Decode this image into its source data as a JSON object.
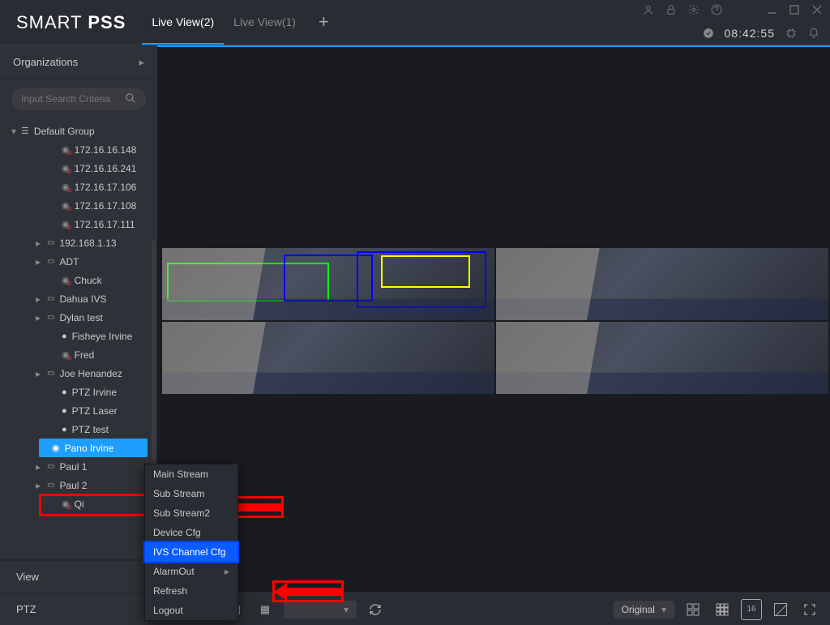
{
  "app": {
    "brand1": "SMART",
    "brand2": "PSS"
  },
  "tabs": [
    {
      "label": "Live View(2)",
      "active": true
    },
    {
      "label": "Live View(1)",
      "active": false
    }
  ],
  "clock": "08:42:55",
  "sidebar_header": "Organizations",
  "search_placeholder": "Input Search Criteria",
  "tree": {
    "group": "Default Group",
    "items": [
      {
        "label": "172.16.16.148",
        "kind": "cam",
        "offline": true
      },
      {
        "label": "172.16.16.241",
        "kind": "cam",
        "offline": true
      },
      {
        "label": "172.16.17.106",
        "kind": "cam",
        "offline": true
      },
      {
        "label": "172.16.17.108",
        "kind": "cam",
        "offline": true
      },
      {
        "label": "172.16.17.111",
        "kind": "cam",
        "offline": true
      },
      {
        "label": "192.168.1.13",
        "kind": "device",
        "expandable": true
      },
      {
        "label": "ADT",
        "kind": "device",
        "expandable": true
      },
      {
        "label": "Chuck",
        "kind": "cam",
        "offline": true
      },
      {
        "label": "Dahua IVS",
        "kind": "device",
        "expandable": true
      },
      {
        "label": "Dylan test",
        "kind": "device",
        "expandable": true
      },
      {
        "label": "Fisheye Irvine",
        "kind": "cam-on"
      },
      {
        "label": "Fred",
        "kind": "cam",
        "offline": true
      },
      {
        "label": "Joe Henandez",
        "kind": "device",
        "expandable": true
      },
      {
        "label": "PTZ Irvine",
        "kind": "cam-on"
      },
      {
        "label": "PTZ Laser",
        "kind": "cam-on"
      },
      {
        "label": "PTZ test",
        "kind": "cam-on"
      },
      {
        "label": "Pano Irvine",
        "kind": "selected"
      },
      {
        "label": "Paul 1",
        "kind": "device",
        "expandable": true
      },
      {
        "label": "Paul 2",
        "kind": "device",
        "expandable": true
      },
      {
        "label": "Qi",
        "kind": "cam",
        "offline": true
      }
    ]
  },
  "context_menu": [
    {
      "label": "Main Stream"
    },
    {
      "label": "Sub Stream"
    },
    {
      "label": "Sub Stream2"
    },
    {
      "label": "Device Cfg"
    },
    {
      "label": "IVS Channel Cfg",
      "selected": true
    },
    {
      "label": "AlarmOut",
      "submenu": true
    },
    {
      "label": "Refresh"
    },
    {
      "label": "Logout"
    }
  ],
  "bottom_tabs": {
    "view": "View",
    "ptz": "PTZ"
  },
  "bottombar": {
    "scale_label": "Original",
    "grid_number": "16"
  }
}
